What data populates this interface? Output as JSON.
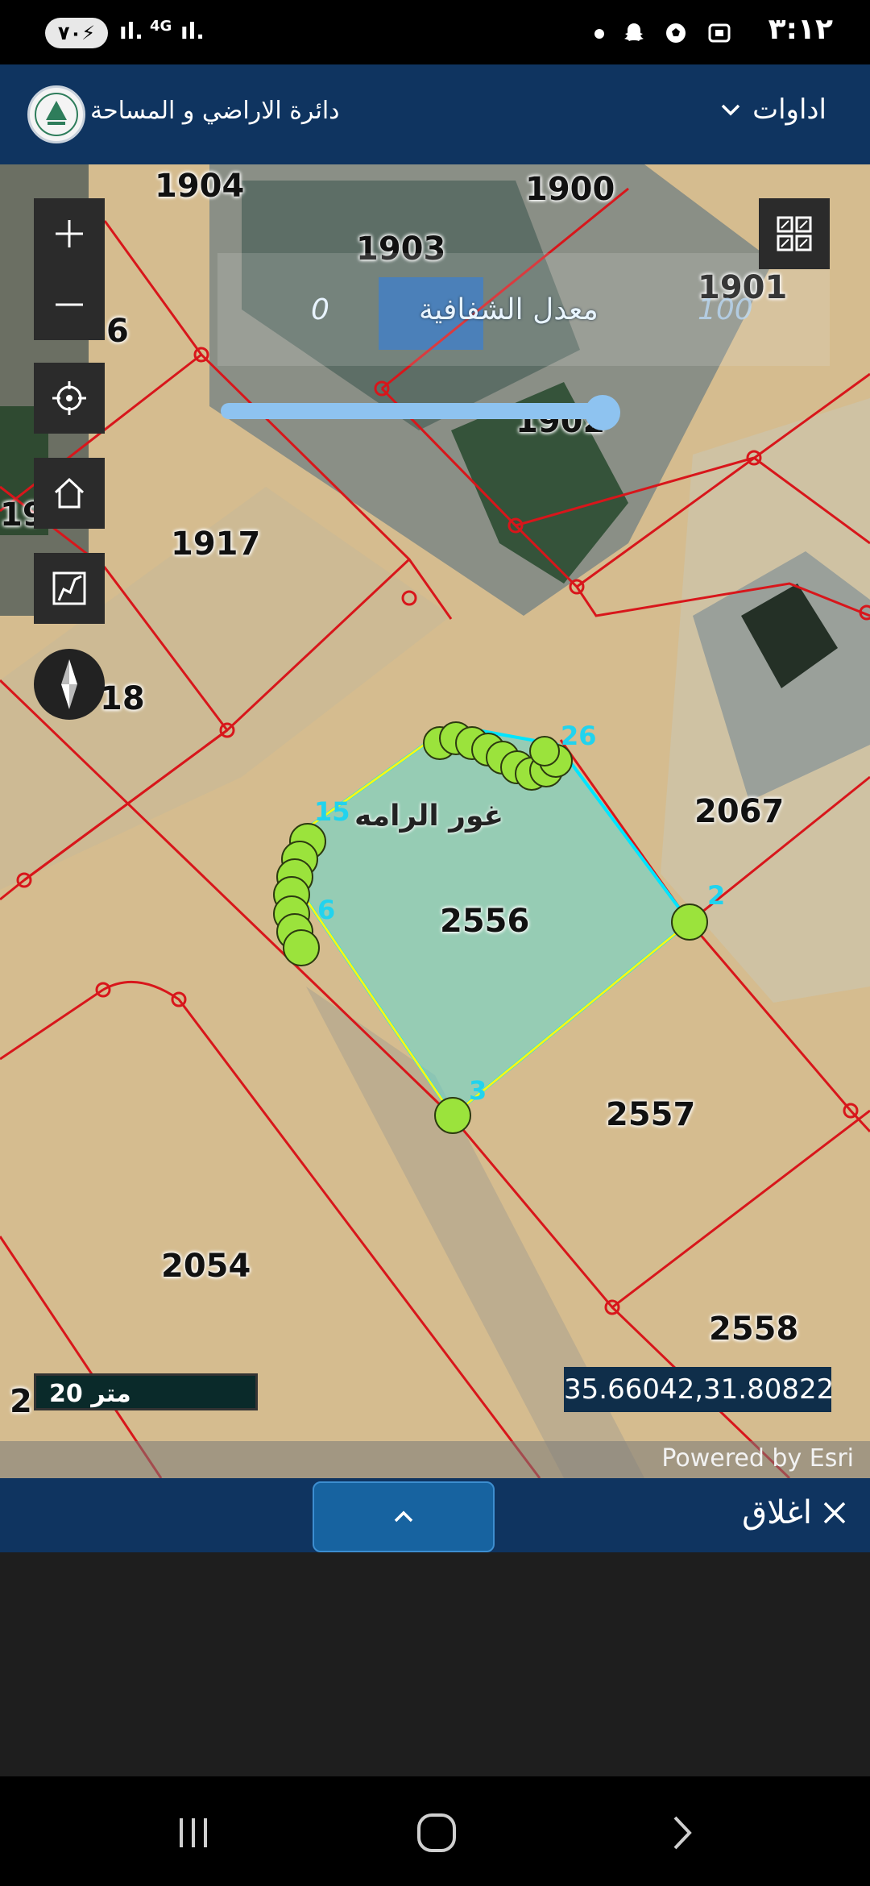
{
  "status_bar": {
    "time": "٣:١٢",
    "battery": "٧٠",
    "network": "4G"
  },
  "app_bar": {
    "title": "دائرة الاراضي و المساحة",
    "tools_label": "اداوات"
  },
  "map": {
    "parcels": [
      "1904",
      "1900",
      "1903",
      "1901",
      "1917",
      "2067",
      "2556",
      "2557",
      "2054",
      "2558"
    ],
    "partial_parcels": [
      "6",
      "18",
      "19",
      "2",
      "1902"
    ],
    "place_name": "غور الرامه",
    "vertex_labels": [
      "2",
      "3",
      "6",
      "15",
      "26"
    ],
    "transparency": {
      "title": "معدل الشفافية",
      "min": "0",
      "max": "100",
      "value": 100
    },
    "scale_label": "20 متر",
    "coordinates": "35.66042,31.80822",
    "attribution": "Powered by Esri"
  },
  "controls": {
    "zoom_in": "zoom-in-icon",
    "zoom_out": "zoom-out-icon",
    "locate": "locate-icon",
    "home": "home-icon",
    "measure": "measure-icon",
    "compass": "compass-icon",
    "basemap": "grid-icon"
  },
  "bottom_panel": {
    "close_label": "اغلاق"
  },
  "colors": {
    "app_bar": "#0f3460",
    "parcel_lines": "#d8161b",
    "selection_fill": "#63d9d4",
    "selection_edge": "#00e5ff",
    "vertex_marker": "#9be33c",
    "slider": "#8ec3f0"
  }
}
